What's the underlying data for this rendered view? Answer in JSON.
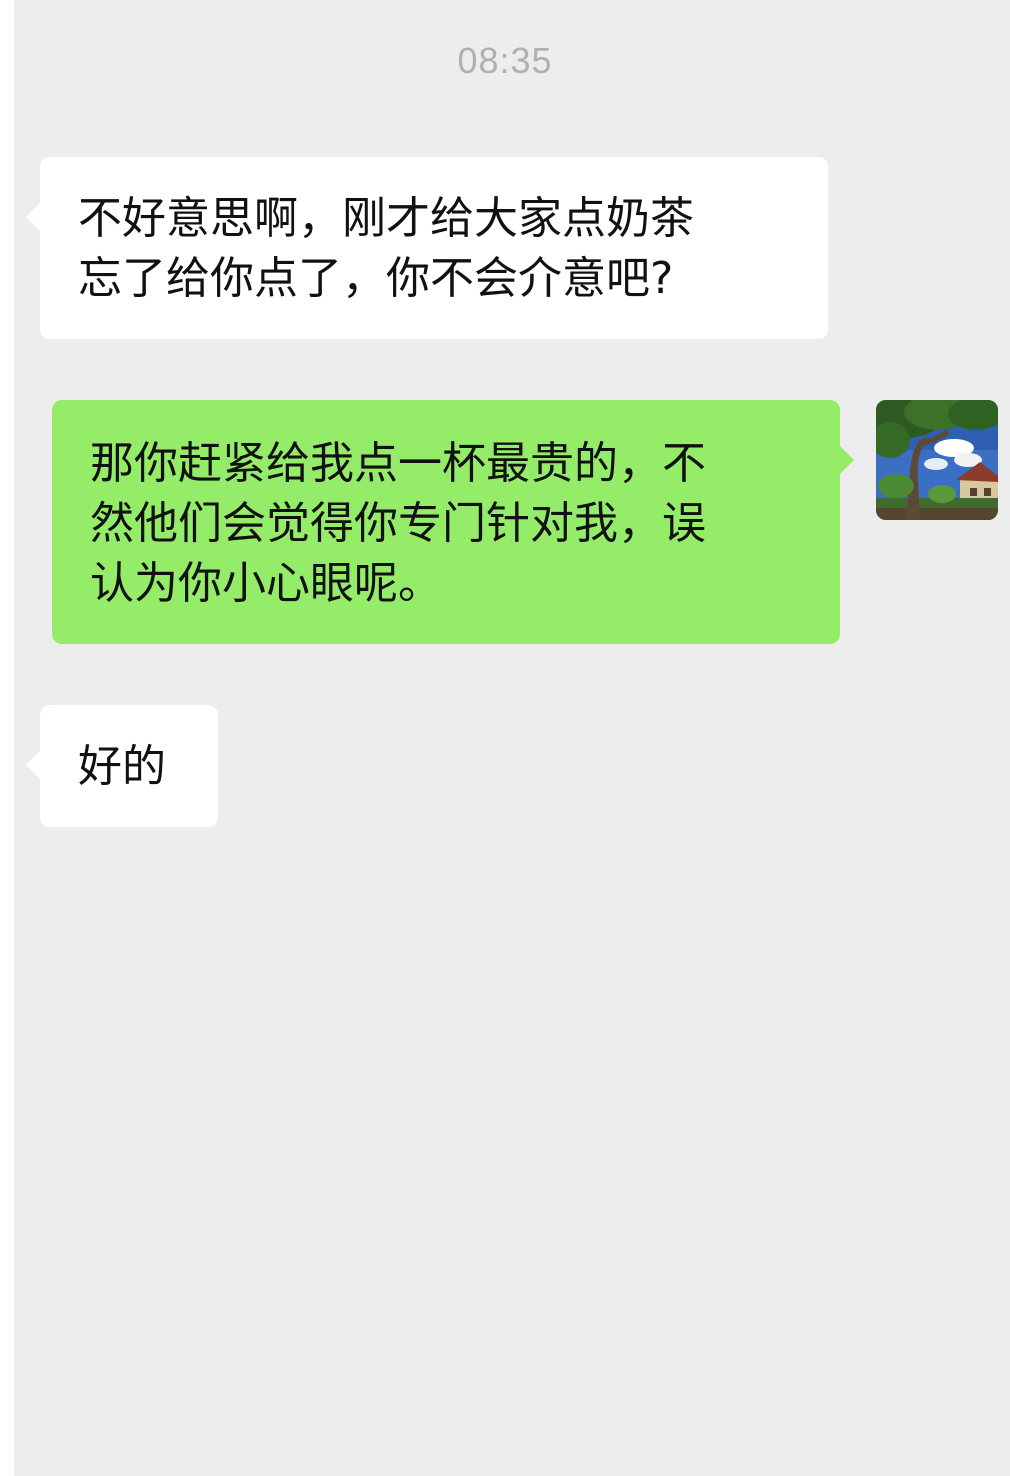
{
  "chat": {
    "timestamp": "08:35",
    "messages": [
      {
        "direction": "incoming",
        "text": "不好意思啊，刚才给大家点奶茶\n忘了给你点了，你不会介意吧?"
      },
      {
        "direction": "outgoing",
        "text": "那你赶紧给我点一杯最贵的，不\n然他们会觉得你专门针对我，误\n认为你小心眼呢。"
      },
      {
        "direction": "incoming",
        "text": "好的"
      }
    ]
  },
  "avatar": {
    "icon": "landscape-avatar-icon"
  },
  "colors": {
    "background": "#ededed",
    "incoming_bubble": "#ffffff",
    "outgoing_bubble": "#95ec69",
    "timestamp_text": "#b0b0b0"
  }
}
